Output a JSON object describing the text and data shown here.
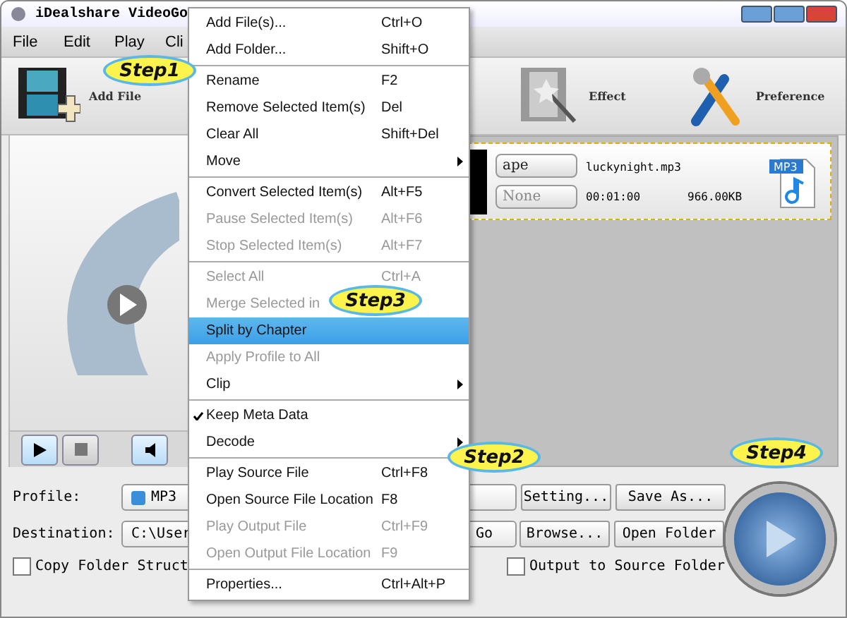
{
  "window": {
    "title": "iDealshare VideoGo"
  },
  "menu_bar": [
    "File",
    "Edit",
    "Play",
    "Cli"
  ],
  "toolbar": [
    {
      "label": "Add File",
      "kind": "add"
    },
    {
      "label": "Effect",
      "kind": "effect"
    },
    {
      "label": "Preference",
      "kind": "preference"
    }
  ],
  "file_list": [
    {
      "format": "ape",
      "subtitle": "None",
      "name": "luckynight.mp3",
      "duration": "00:01:00",
      "size": "966.00KB",
      "badge": "MP3"
    }
  ],
  "context_menu": [
    {
      "kind": "item",
      "label": "Add File(s)...",
      "shortcut": "Ctrl+O",
      "disabled": false,
      "selected": false,
      "checked": false,
      "submenu": false
    },
    {
      "kind": "item",
      "label": "Add Folder...",
      "shortcut": "Shift+O",
      "disabled": false,
      "selected": false,
      "checked": false,
      "submenu": false
    },
    {
      "kind": "separator"
    },
    {
      "kind": "item",
      "label": "Rename",
      "shortcut": "F2",
      "disabled": false,
      "selected": false,
      "checked": false,
      "submenu": false
    },
    {
      "kind": "item",
      "label": "Remove Selected Item(s)",
      "shortcut": "Del",
      "disabled": false,
      "selected": false,
      "checked": false,
      "submenu": false
    },
    {
      "kind": "item",
      "label": "Clear All",
      "shortcut": "Shift+Del",
      "disabled": false,
      "selected": false,
      "checked": false,
      "submenu": false
    },
    {
      "kind": "item",
      "label": "Move",
      "disabled": false,
      "selected": false,
      "checked": false,
      "submenu": true
    },
    {
      "kind": "separator"
    },
    {
      "kind": "item",
      "label": "Convert Selected Item(s)",
      "shortcut": "Alt+F5",
      "disabled": false,
      "selected": false,
      "checked": false,
      "submenu": false
    },
    {
      "kind": "item",
      "label": "Pause Selected Item(s)",
      "shortcut": "Alt+F6",
      "disabled": true,
      "selected": false,
      "checked": false,
      "submenu": false
    },
    {
      "kind": "item",
      "label": "Stop Selected Item(s)",
      "shortcut": "Alt+F7",
      "disabled": true,
      "selected": false,
      "checked": false,
      "submenu": false
    },
    {
      "kind": "separator"
    },
    {
      "kind": "item",
      "label": "Select All",
      "shortcut": "Ctrl+A",
      "disabled": true,
      "selected": false,
      "checked": false,
      "submenu": false
    },
    {
      "kind": "item",
      "label": "Merge Selected in",
      "disabled": true,
      "selected": false,
      "checked": false,
      "submenu": false
    },
    {
      "kind": "item",
      "label": "Split by Chapter",
      "disabled": false,
      "selected": true,
      "checked": false,
      "submenu": false
    },
    {
      "kind": "item",
      "label": "Apply Profile to All",
      "disabled": true,
      "selected": false,
      "checked": false,
      "submenu": false
    },
    {
      "kind": "item",
      "label": "Clip",
      "disabled": false,
      "selected": false,
      "checked": false,
      "submenu": true
    },
    {
      "kind": "separator"
    },
    {
      "kind": "item",
      "label": "Keep Meta Data",
      "disabled": false,
      "selected": false,
      "checked": true,
      "submenu": false
    },
    {
      "kind": "item",
      "label": "Decode",
      "disabled": false,
      "selected": false,
      "checked": false,
      "submenu": true
    },
    {
      "kind": "separator"
    },
    {
      "kind": "item",
      "label": "Play Source File",
      "shortcut": "Ctrl+F8",
      "disabled": false,
      "selected": false,
      "checked": false,
      "submenu": false
    },
    {
      "kind": "item",
      "label": "Open Source File Location",
      "shortcut": "F8",
      "disabled": false,
      "selected": false,
      "checked": false,
      "submenu": false
    },
    {
      "kind": "item",
      "label": "Play Output File",
      "shortcut": "Ctrl+F9",
      "disabled": true,
      "selected": false,
      "checked": false,
      "submenu": false
    },
    {
      "kind": "item",
      "label": "Open Output File Location",
      "shortcut": "F9",
      "disabled": true,
      "selected": false,
      "checked": false,
      "submenu": false
    },
    {
      "kind": "separator"
    },
    {
      "kind": "item",
      "label": "Properties...",
      "shortcut": "Ctrl+Alt+P",
      "disabled": false,
      "selected": false,
      "checked": false,
      "submenu": false
    }
  ],
  "profile": {
    "label": "Profile:",
    "value": "MP3",
    "buttons": [
      "Setting...",
      "Save As..."
    ]
  },
  "destination": {
    "label": "Destination:",
    "value": "C:\\User",
    "go": "Go",
    "buttons": [
      "Browse...",
      "Open Folder"
    ]
  },
  "options": [
    {
      "label": "Copy Folder Struct",
      "checked": false
    },
    {
      "label": "Output to Source Folder",
      "checked": false
    }
  ],
  "callouts": [
    "Step1",
    "Step2",
    "Step3",
    "Step4"
  ]
}
